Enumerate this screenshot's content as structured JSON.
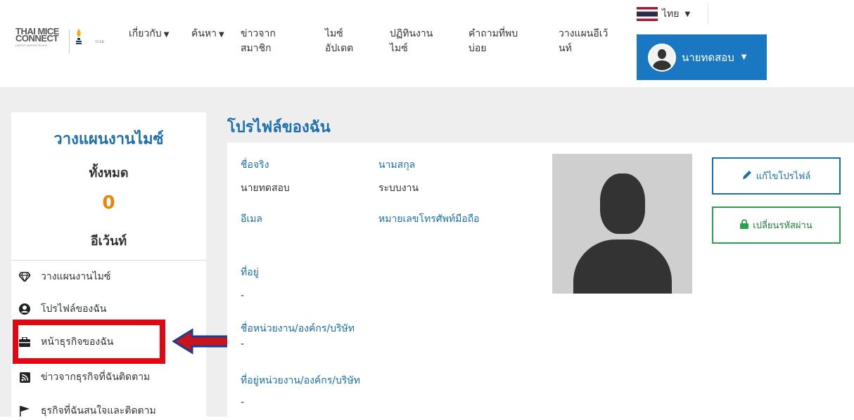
{
  "header": {
    "logo": {
      "line1": "THAI MICE",
      "line2": "CONNECT",
      "tagline": "UNITED MARKETPLACE",
      "partner": "TCEB"
    },
    "nav": [
      {
        "label": "เกี่ยวกับ",
        "has_caret": true
      },
      {
        "label": "ค้นหา",
        "has_caret": true
      },
      {
        "label": "ข่าวจาก\nสมาชิก",
        "has_caret": false
      },
      {
        "label": "ไมซ์\nอัปเดต",
        "has_caret": false
      },
      {
        "label": "ปฏิทินงาน\nไมซ์",
        "has_caret": false
      },
      {
        "label": "คำถามที่พบ\nบ่อย",
        "has_caret": false
      },
      {
        "label": "วางแผนอีเว้\nนท์",
        "has_caret": false
      }
    ],
    "language": {
      "label": "ไทย",
      "flag": "thai-flag-icon"
    },
    "user": {
      "name": "นายทดสอบ"
    },
    "accent_color": "#1a78c2"
  },
  "sidebar": {
    "title": "วางแผนงานไมซ์",
    "total_label": "ทั้งหมด",
    "count": "0",
    "unit": "อีเว้นท์",
    "menu": [
      {
        "label": "วางแผนงานไมซ์",
        "icon": "diamond-icon"
      },
      {
        "label": "โปรไฟล์ของฉัน",
        "icon": "user-circle-icon"
      },
      {
        "label": "หน้าธุรกิจของฉัน",
        "icon": "briefcase-icon"
      },
      {
        "label": "ข่าวจากธุรกิจที่ฉันติดตาม",
        "icon": "rss-icon"
      },
      {
        "label": "ธุรกิจที่ฉันสนใจและติดตาม",
        "icon": "flag-icon"
      }
    ]
  },
  "profile": {
    "title": "โปรไฟล์ของฉัน",
    "first_name_label": "ชื่อจริง",
    "first_name": "นายทดสอบ",
    "last_name_label": "นามสกุล",
    "last_name": "ระบบงาน",
    "email_label": "อีเมล",
    "phone_label": "หมายเลขโทรศัพท์มือถือ",
    "address_label": "ที่อยู่",
    "address": "-",
    "org_label": "ชื่อหน่วยงาน/องค์กร/บริษัท",
    "org": "-",
    "org_address_label": "ที่อยู่หน่วยงาน/องค์กร/บริษัท",
    "org_address": "-",
    "edit_button": "แก้ไขโปรไฟล์",
    "change_password_button": "เปลี่ยนรหัสผ่าน"
  }
}
